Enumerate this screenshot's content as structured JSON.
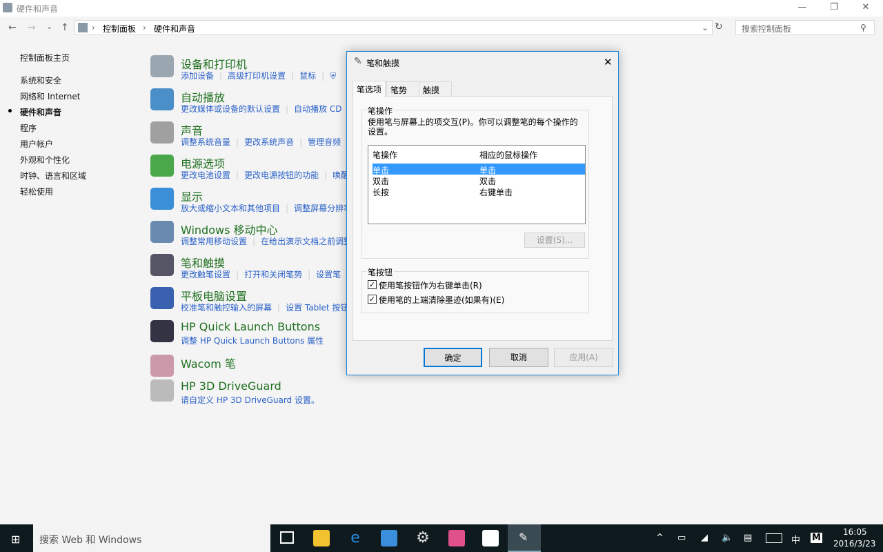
{
  "window": {
    "title": "硬件和声音",
    "min": "—",
    "max": "❐",
    "close": "✕"
  },
  "address": {
    "back": "←",
    "forward": "→",
    "dropdown": "⌄",
    "up": "↑",
    "crumbs": [
      "控制面板",
      "硬件和声音"
    ],
    "sep": "›",
    "refresh": "↻",
    "search_placeholder": "搜索控制面板"
  },
  "sidebar": {
    "items": [
      {
        "label": "控制面板主页"
      },
      {
        "label": "系统和安全"
      },
      {
        "label": "网络和 Internet"
      },
      {
        "label": "硬件和声音",
        "active": true
      },
      {
        "label": "程序"
      },
      {
        "label": "用户帐户"
      },
      {
        "label": "外观和个性化"
      },
      {
        "label": "时钟、语言和区域"
      },
      {
        "label": "轻松使用"
      }
    ]
  },
  "categories": [
    {
      "title": "设备和打印机",
      "icon": "printer-icon",
      "links": [
        "添加设备",
        "高级打印机设置",
        "鼠标"
      ]
    },
    {
      "title": "自动播放",
      "icon": "autoplay-icon",
      "links": [
        "更改媒体或设备的默认设置",
        "自动播放 CD"
      ]
    },
    {
      "title": "声音",
      "icon": "speaker-icon",
      "links": [
        "调整系统音量",
        "更改系统声音",
        "管理音频"
      ]
    },
    {
      "title": "电源选项",
      "icon": "battery-icon",
      "links": [
        "更改电池设置",
        "更改电源按钮的功能",
        "唤醒"
      ]
    },
    {
      "title": "显示",
      "icon": "monitor-icon",
      "links": [
        "放大或缩小文本和其他项目",
        "调整屏幕分辨率"
      ]
    },
    {
      "title": "Windows 移动中心",
      "icon": "mobility-icon",
      "links": [
        "调整常用移动设置",
        "在给出演示文档之前调整"
      ]
    },
    {
      "title": "笔和触摸",
      "icon": "pen-icon",
      "links": [
        "更改触笔设置",
        "打开和关闭笔势",
        "设置笔"
      ]
    },
    {
      "title": "平板电脑设置",
      "icon": "tablet-icon",
      "links": [
        "校准笔和触控输入的屏幕",
        "设置 Tablet 按钮"
      ]
    },
    {
      "title": "HP Quick Launch Buttons",
      "icon": "rocket-icon",
      "links": [
        "调整 HP Quick Launch Buttons 属性"
      ]
    },
    {
      "title": "Wacom 笔",
      "icon": "wacom-icon",
      "links": []
    },
    {
      "title": "HP 3D DriveGuard",
      "icon": "drive-icon",
      "links": [
        "请自定义 HP 3D DriveGuard 设置。"
      ]
    }
  ],
  "dialog": {
    "title": "笔和触摸",
    "close": "✕",
    "tabs": [
      "笔选项",
      "笔势",
      "触摸"
    ],
    "pen_actions": {
      "label": "笔操作",
      "desc": "使用笔与屏幕上的项交互(P)。你可以调整笔的每个操作的设置。",
      "columns": [
        "笔操作",
        "相应的鼠标操作"
      ],
      "rows": [
        {
          "action": "单击",
          "mouse": "单击",
          "selected": true
        },
        {
          "action": "双击",
          "mouse": "双击"
        },
        {
          "action": "长按",
          "mouse": "右键单击"
        }
      ],
      "settings": "设置(S)..."
    },
    "pen_buttons": {
      "label": "笔按钮",
      "options": [
        {
          "label": "使用笔按钮作为右键单击(R)",
          "checked": true
        },
        {
          "label": "使用笔的上端清除墨迹(如果有)(E)",
          "checked": true
        }
      ]
    },
    "ok": "确定",
    "cancel": "取消",
    "apply": "应用(A)"
  },
  "taskbar": {
    "search": "搜索 Web 和 Windows",
    "clock_time": "16:05",
    "clock_date": "2016/3/23",
    "ime": "中",
    "ime_mode": "M",
    "chevron": "^"
  },
  "colors": {
    "accent": "#1883d7",
    "selection": "#3399ff",
    "link": "#2a61c8",
    "heading": "#1e6f1e",
    "taskbar": "#0f1a1f"
  }
}
